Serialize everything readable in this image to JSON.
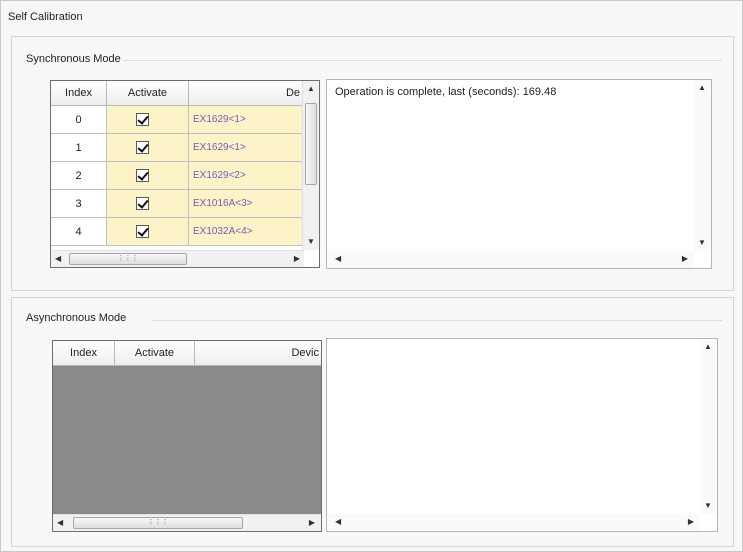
{
  "window": {
    "title": "Self Calibration"
  },
  "sync": {
    "group_label": "Synchronous Mode",
    "columns": [
      "Index",
      "Activate",
      "De"
    ],
    "rows": [
      {
        "index": "0",
        "activate": true,
        "device": "EX1629<1>"
      },
      {
        "index": "1",
        "activate": true,
        "device": "EX1629<1>"
      },
      {
        "index": "2",
        "activate": true,
        "device": "EX1629<2>"
      },
      {
        "index": "3",
        "activate": true,
        "device": "EX1016A<3>"
      },
      {
        "index": "4",
        "activate": true,
        "device": "EX1032A<4>"
      }
    ],
    "output_text": "Operation is complete, last (seconds): 169.48"
  },
  "async": {
    "group_label": "Asynchronous Mode",
    "columns": [
      "Index",
      "Activate",
      "Devic"
    ],
    "rows": [],
    "output_text": ""
  },
  "icons": {
    "up": "scroll-up-arrow",
    "down": "scroll-down-arrow",
    "left": "scroll-left-arrow",
    "right": "scroll-right-arrow",
    "grip": "scroll-grip"
  },
  "colors": {
    "cell_highlight": "#fdf3c8",
    "device_text": "#7a5ab0",
    "empty_grid": "#8a8a8a"
  }
}
